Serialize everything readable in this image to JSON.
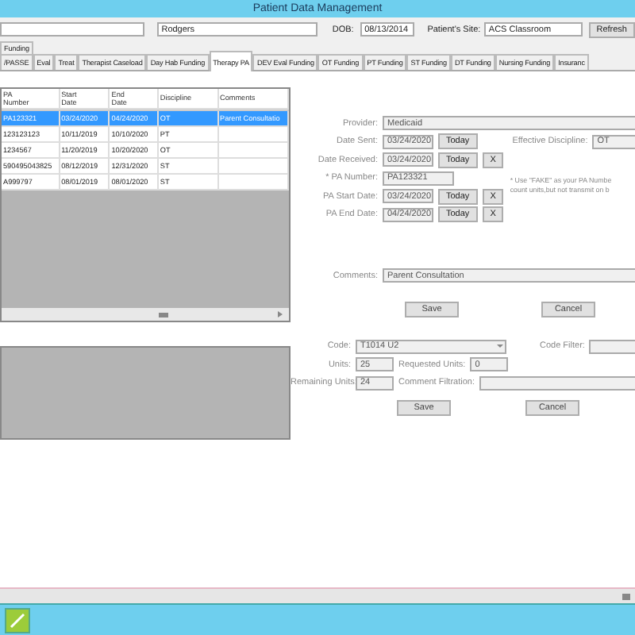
{
  "window": {
    "title": "Patient Data Management"
  },
  "patient": {
    "last_name_field": {
      "value": "Rodgers"
    },
    "dob_label": "DOB:",
    "dob_field": {
      "value": "08/13/2014"
    },
    "site_label": "Patient's Site:",
    "site_field": {
      "value": "ACS Classroom"
    },
    "refresh_button": "Refresh"
  },
  "tabs_row_1": [
    {
      "label": "Funding",
      "selected": false
    }
  ],
  "tabs_row_2": [
    {
      "label": "/PASSE",
      "selected": false
    },
    {
      "label": "Eval",
      "selected": false
    },
    {
      "label": "Treat",
      "selected": false
    },
    {
      "label": "Therapist Caseload",
      "selected": false
    },
    {
      "label": "Day Hab Funding",
      "selected": false
    },
    {
      "label": "Therapy PA",
      "selected": true
    },
    {
      "label": "DEV Eval Funding",
      "selected": false
    },
    {
      "label": "OT Funding",
      "selected": false
    },
    {
      "label": "PT Funding",
      "selected": false
    },
    {
      "label": "ST Funding",
      "selected": false
    },
    {
      "label": "DT Funding",
      "selected": false
    },
    {
      "label": "Nursing Funding",
      "selected": false
    },
    {
      "label": "Insuranc",
      "selected": false
    }
  ],
  "pa_table": {
    "columns": [
      "PA\nNumber",
      "Start\nDate",
      "End\nDate",
      "Discipline",
      "Comments"
    ],
    "rows": [
      {
        "cells": [
          "PA123321",
          "03/24/2020",
          "04/24/2020",
          "OT",
          "Parent Consultatio"
        ],
        "selected": true
      },
      {
        "cells": [
          "123123123",
          "10/11/2019",
          "10/10/2020",
          "PT",
          ""
        ],
        "selected": false
      },
      {
        "cells": [
          "1234567",
          "11/20/2019",
          "10/20/2020",
          "OT",
          ""
        ],
        "selected": false
      },
      {
        "cells": [
          "590495043825",
          "08/12/2019",
          "12/31/2020",
          "ST",
          ""
        ],
        "selected": false
      },
      {
        "cells": [
          "A999797",
          "08/01/2019",
          "08/01/2020",
          "ST",
          ""
        ],
        "selected": false
      }
    ]
  },
  "pa_form": {
    "provider": {
      "label": "Provider:",
      "value": "Medicaid"
    },
    "date_sent": {
      "label": "Date Sent:",
      "value": "03/24/2020",
      "today": "Today"
    },
    "effective_discipline": {
      "label": "Effective Discipline:",
      "value": "OT"
    },
    "date_received": {
      "label": "Date Received:",
      "value": "03/24/2020",
      "today": "Today",
      "clear": "X"
    },
    "pa_number": {
      "label": "* PA Number:",
      "value": "PA123321"
    },
    "note": [
      "* Use \"FAKE\" as your PA Numbe",
      "count units,but not transmit on b"
    ],
    "pa_start_date": {
      "label": "PA Start Date:",
      "value": "03/24/2020",
      "today": "Today",
      "clear": "X"
    },
    "pa_end_date": {
      "label": "PA End Date:",
      "value": "04/24/2020",
      "today": "Today",
      "clear": "X"
    },
    "comments": {
      "label": "Comments:",
      "value": "Parent Consultation"
    },
    "buttons": [
      "Save",
      "Cancel"
    ]
  },
  "code_form": {
    "code": {
      "label": "Code:",
      "value": "T1014 U2"
    },
    "code_filter": {
      "label": "Code Filter:"
    },
    "units": {
      "label": "Units:",
      "value": "25"
    },
    "requested_units": {
      "label": "Requested Units:",
      "value": "0"
    },
    "remaining_units": {
      "label": "Remaining Units:",
      "value": "24"
    },
    "comment_filtration": {
      "label": "Comment Filtration:"
    },
    "buttons": [
      "Save",
      "Cancel"
    ]
  }
}
